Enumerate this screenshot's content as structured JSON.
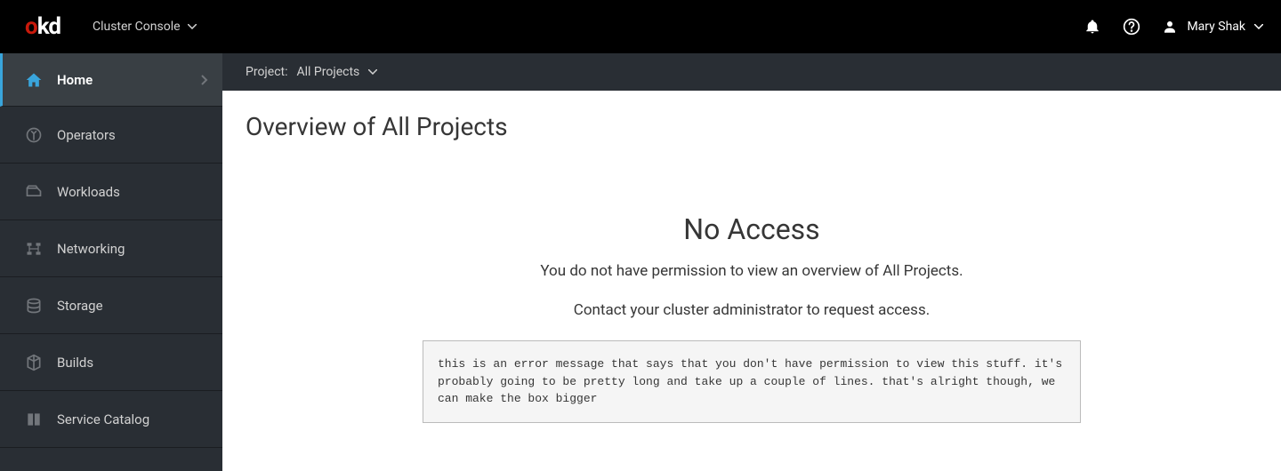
{
  "topbar": {
    "logo_o": "o",
    "logo_kd": "kd",
    "console_selector": "Cluster Console",
    "user_name": "Mary Shak"
  },
  "sidebar": {
    "items": [
      {
        "label": "Home",
        "icon": "home-icon",
        "active": true
      },
      {
        "label": "Operators",
        "icon": "operators-icon"
      },
      {
        "label": "Workloads",
        "icon": "workloads-icon"
      },
      {
        "label": "Networking",
        "icon": "networking-icon"
      },
      {
        "label": "Storage",
        "icon": "storage-icon"
      },
      {
        "label": "Builds",
        "icon": "builds-icon"
      },
      {
        "label": "Service Catalog",
        "icon": "catalog-icon"
      }
    ]
  },
  "project_bar": {
    "label": "Project:",
    "value": "All Projects"
  },
  "page": {
    "title": "Overview of All Projects"
  },
  "empty_state": {
    "title": "No Access",
    "line1": "You do not have permission to view an overview of All Projects.",
    "line2": "Contact your cluster administrator to request access.",
    "error_message": "this is an error message that says that you don't have permission to view this stuff. it's probably going to be pretty long and take up a couple of lines. that's alright though, we can make the box bigger"
  }
}
